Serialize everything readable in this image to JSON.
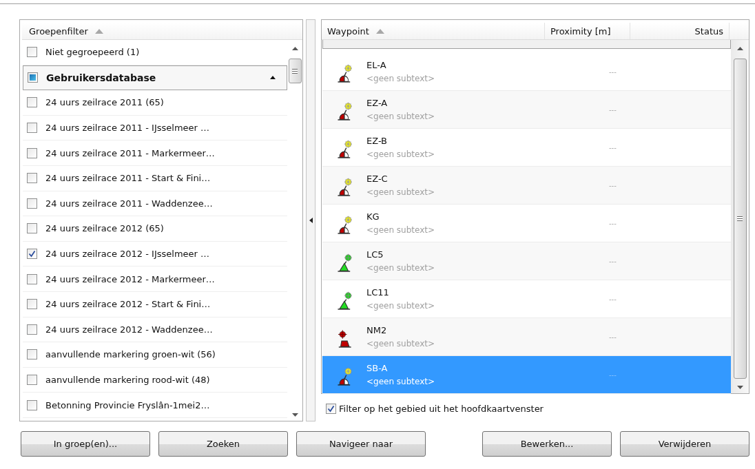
{
  "group_filter": {
    "column": "Groepenfilter",
    "items": [
      {
        "label": "Niet gegroepeerd (1)",
        "kind": "item",
        "checked": false,
        "partial": false
      },
      {
        "label": "Gebruikersdatabase",
        "kind": "group",
        "checked": false,
        "partial": true,
        "expanded": true
      },
      {
        "label": "24 uurs zeilrace 2011 (65)",
        "kind": "item",
        "checked": false,
        "partial": false
      },
      {
        "label": "24 uurs zeilrace 2011 - IJsselmeer …",
        "kind": "item",
        "checked": false,
        "partial": false
      },
      {
        "label": "24 uurs zeilrace 2011 - Markermeer…",
        "kind": "item",
        "checked": false,
        "partial": false
      },
      {
        "label": "24 uurs zeilrace 2011 - Start & Fini…",
        "kind": "item",
        "checked": false,
        "partial": false
      },
      {
        "label": "24 uurs zeilrace 2011 - Waddenzee…",
        "kind": "item",
        "checked": false,
        "partial": false
      },
      {
        "label": "24 uurs zeilrace 2012 (65)",
        "kind": "item",
        "checked": false,
        "partial": false
      },
      {
        "label": "24 uurs zeilrace 2012 - IJsselmeer …",
        "kind": "item",
        "checked": true,
        "partial": false
      },
      {
        "label": "24 uurs zeilrace 2012 - Markermeer…",
        "kind": "item",
        "checked": false,
        "partial": false
      },
      {
        "label": "24 uurs zeilrace 2012 - Start & Fini…",
        "kind": "item",
        "checked": false,
        "partial": false
      },
      {
        "label": "24 uurs zeilrace 2012 - Waddenzee…",
        "kind": "item",
        "checked": false,
        "partial": false
      },
      {
        "label": "aanvullende markering groen-wit (56)",
        "kind": "item",
        "checked": false,
        "partial": false
      },
      {
        "label": "aanvullende markering rood-wit (48)",
        "kind": "item",
        "checked": false,
        "partial": false
      },
      {
        "label": "Betonning Provincie Fryslân-1mei2…",
        "kind": "item",
        "checked": false,
        "partial": false
      }
    ]
  },
  "waypoints": {
    "columns": [
      "Waypoint",
      "Proximity [m]",
      "Status"
    ],
    "rows": [
      {
        "name": "EL-A",
        "subtext": "<geen subtext>",
        "proximity": "---",
        "kind": "yellow",
        "selected": false
      },
      {
        "name": "EZ-A",
        "subtext": "<geen subtext>",
        "proximity": "---",
        "kind": "yellow",
        "selected": false
      },
      {
        "name": "EZ-B",
        "subtext": "<geen subtext>",
        "proximity": "---",
        "kind": "yellow",
        "selected": false
      },
      {
        "name": "EZ-C",
        "subtext": "<geen subtext>",
        "proximity": "---",
        "kind": "yellow",
        "selected": false
      },
      {
        "name": "KG",
        "subtext": "<geen subtext>",
        "proximity": "---",
        "kind": "yellow",
        "selected": false
      },
      {
        "name": "LC5",
        "subtext": "<geen subtext>",
        "proximity": "---",
        "kind": "green",
        "selected": false
      },
      {
        "name": "LC11",
        "subtext": "<geen subtext>",
        "proximity": "---",
        "kind": "green",
        "selected": false
      },
      {
        "name": "NM2",
        "subtext": "<geen subtext>",
        "proximity": "---",
        "kind": "red",
        "selected": false
      },
      {
        "name": "SB-A",
        "subtext": "<geen subtext>",
        "proximity": "---",
        "kind": "yellow",
        "selected": true
      }
    ]
  },
  "area_filter": {
    "label": "Filter op het gebied uit het hoofdkaartvenster",
    "checked": true
  },
  "buttons": [
    "In groep(en)...",
    "Zoeken",
    "Navigeer naar",
    "Bewerken...",
    "Verwijderen"
  ]
}
